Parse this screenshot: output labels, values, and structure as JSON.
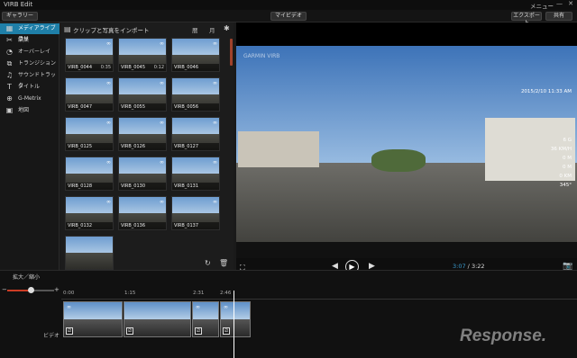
{
  "app": {
    "title": "VIRB Edit",
    "menu_label": "メニュー",
    "minimize_glyph": "—",
    "close_glyph": "✕"
  },
  "toolbar": {
    "gallery_label": "ギャラリー",
    "my_video_label": "マイビデオ",
    "export_label": "エクスポート",
    "share_label": "共有"
  },
  "sidebar": {
    "items": [
      {
        "label": "メディアライブラリ",
        "icon": "film-icon",
        "glyph": "▦",
        "active": true
      },
      {
        "label": "編集",
        "icon": "scissors-icon",
        "glyph": "✂",
        "active": false
      },
      {
        "label": "オーバーレイ",
        "icon": "gauge-icon",
        "glyph": "◔",
        "active": false
      },
      {
        "label": "トランジション",
        "icon": "transition-icon",
        "glyph": "⧉",
        "active": false
      },
      {
        "label": "サウンドトラック",
        "icon": "music-icon",
        "glyph": "♫",
        "active": false
      },
      {
        "label": "タイトル",
        "icon": "text-icon",
        "glyph": "T",
        "active": false
      },
      {
        "label": "G-Metrix",
        "icon": "gmetrix-icon",
        "glyph": "⊕",
        "active": false
      },
      {
        "label": "地図",
        "icon": "map-icon",
        "glyph": "▣",
        "active": false
      }
    ]
  },
  "media": {
    "header": "クリップと写真をインポート",
    "header_icon": "▤",
    "calendar_label": "暦",
    "month_label": "月",
    "gear_glyph": "✱",
    "thumbs": [
      {
        "name": "VIRB_0044",
        "dur": "0:35"
      },
      {
        "name": "VIRB_0045",
        "dur": "0:12"
      },
      {
        "name": "VIRB_0046",
        "dur": ""
      },
      {
        "name": "VIRB_0047",
        "dur": ""
      },
      {
        "name": "VIRB_0055",
        "dur": ""
      },
      {
        "name": "VIRB_0056",
        "dur": ""
      },
      {
        "name": "VIRB_0125",
        "dur": ""
      },
      {
        "name": "VIRB_0126",
        "dur": ""
      },
      {
        "name": "VIRB_0127",
        "dur": ""
      },
      {
        "name": "VIRB_0128",
        "dur": ""
      },
      {
        "name": "VIRB_0130",
        "dur": ""
      },
      {
        "name": "VIRB_0131",
        "dur": ""
      },
      {
        "name": "VIRB_0132",
        "dur": ""
      },
      {
        "name": "VIRB_0136",
        "dur": ""
      },
      {
        "name": "VIRB_0137",
        "dur": ""
      },
      {
        "name": "",
        "dur": ""
      }
    ],
    "refresh_glyph": "↻",
    "trash_glyph": "🗑"
  },
  "viewer": {
    "watermark": "GARMIN VIRB",
    "gauges": [
      "2015/2/10 11:33 AM",
      "6 G",
      "36 KM/H",
      "0 M",
      "0 M",
      "0 KM",
      "345°"
    ],
    "fit_glyph": "⛶",
    "prev_glyph": "◀",
    "play_glyph": "▶",
    "next_glyph": "▶",
    "camera_glyph": "📷",
    "current_time": "3:07",
    "separator": " / ",
    "total_time": "3:22"
  },
  "timeline": {
    "zoom_label": "拡大／縮小",
    "zoom_level": 0.5,
    "minus_glyph": "−",
    "plus_glyph": "+",
    "ticks": [
      "0:00",
      "1:15",
      "2:31",
      "2:46"
    ],
    "track_label": "ビデオ",
    "logo_text": "Response."
  },
  "colors": {
    "accent": "#1f7fa8",
    "scroll_accent": "#a0422c",
    "zoom_fill": "#cc3c24",
    "time_current": "#3a9bcf"
  }
}
